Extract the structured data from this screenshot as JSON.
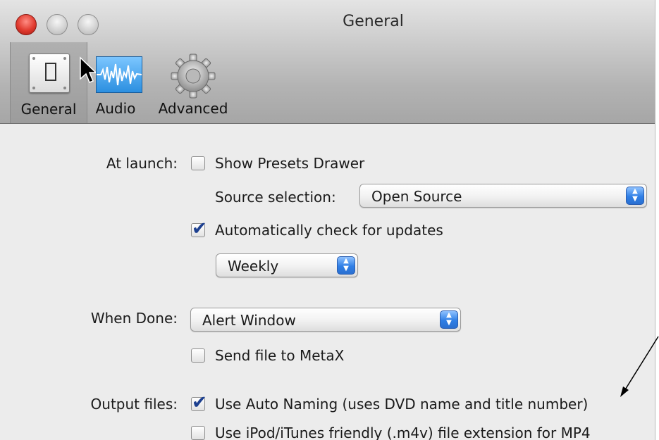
{
  "window": {
    "title": "General"
  },
  "toolbar": {
    "items": [
      {
        "label": "General",
        "icon": "switch-icon"
      },
      {
        "label": "Audio",
        "icon": "audio-waveform-icon"
      },
      {
        "label": "Advanced",
        "icon": "gear-icon"
      }
    ]
  },
  "at_launch": {
    "label": "At launch:",
    "show_presets_drawer": {
      "label": "Show Presets Drawer",
      "checked": false
    },
    "source_selection": {
      "label": "Source selection:",
      "value": "Open Source"
    },
    "auto_update": {
      "label": "Automatically check for updates",
      "checked": true
    },
    "update_frequency": {
      "value": "Weekly"
    }
  },
  "when_done": {
    "label": "When Done:",
    "value": "Alert Window",
    "send_to_metax": {
      "label": "Send file to MetaX",
      "checked": false
    }
  },
  "output_files": {
    "label": "Output files:",
    "auto_naming": {
      "label": "Use Auto Naming (uses DVD name and title number)",
      "checked": true
    },
    "m4v_extension": {
      "label": "Use iPod/iTunes friendly (.m4v) file extension for MP4",
      "checked": false
    }
  },
  "colors": {
    "accent": "#2f7fe6",
    "checkmark": "#1c3f8f",
    "close_button": "#e03a2e"
  }
}
